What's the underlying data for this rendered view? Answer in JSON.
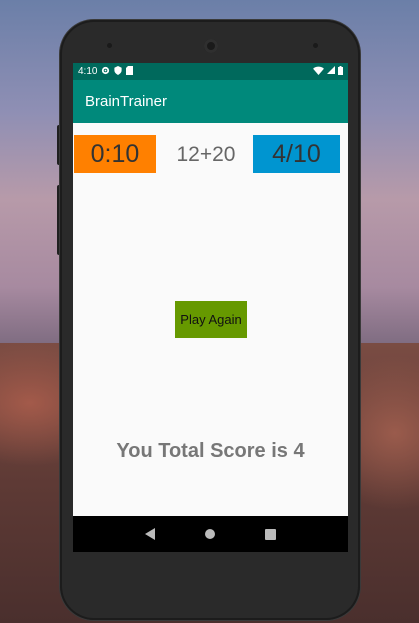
{
  "status_bar": {
    "time": "4:10",
    "icons_left": [
      "gear-icon",
      "shield-icon",
      "sdcard-icon"
    ],
    "icons_right": [
      "wifi-icon",
      "signal-icon",
      "battery-icon"
    ]
  },
  "app_bar": {
    "title": "BrainTrainer"
  },
  "game": {
    "timer": "0:10",
    "sum": "12+20",
    "score": "4/10"
  },
  "play_again_label": "Play Again",
  "result_text": "You Total Score is 4",
  "nav_bar": {
    "items": [
      "back-icon",
      "home-icon",
      "recents-icon"
    ]
  },
  "colors": {
    "status_bar": "#00695c",
    "app_bar": "#00897b",
    "timer_bg": "#ff8000",
    "score_bg": "#0095d0",
    "button_bg": "#669900"
  }
}
